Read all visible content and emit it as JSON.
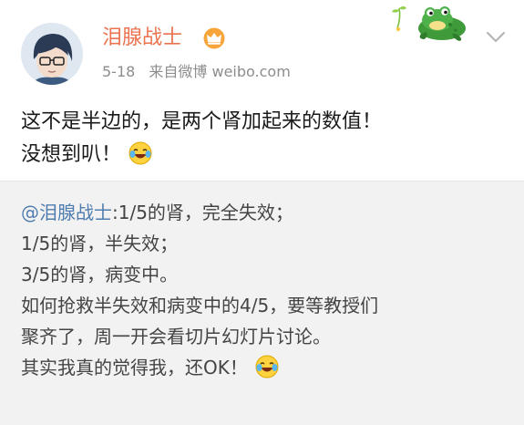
{
  "post": {
    "author": {
      "name": "泪腺战士",
      "badge_icon": "crown-icon"
    },
    "time": "5-18",
    "source": "来自微博 weibo.com",
    "status_lines": [
      "这不是半边的，是两个肾加起来的数值！",
      "没想到叭！"
    ],
    "status_emoji": "laugh-cry-emoji",
    "decoration_icon": "frog-sticker-icon",
    "menu_icon": "chevron-down-icon"
  },
  "retweet": {
    "mention": "@泪腺战士",
    "first_line_rest": ":1/5的肾，完全失效；",
    "lines": [
      "1/5的肾，半失效；",
      "3/5的肾，病变中。",
      "如何抢救半失效和病变中的4/5，要等教授们",
      "聚齐了，周一开会看切片幻灯片讨论。",
      "其实我真的觉得我，还OK！"
    ],
    "emoji": "laugh-cry-emoji"
  },
  "colors": {
    "username": "#eb7350",
    "mention": "#507daf",
    "retweet_bg": "#f2f2f2",
    "meta": "#8d8d8d"
  }
}
